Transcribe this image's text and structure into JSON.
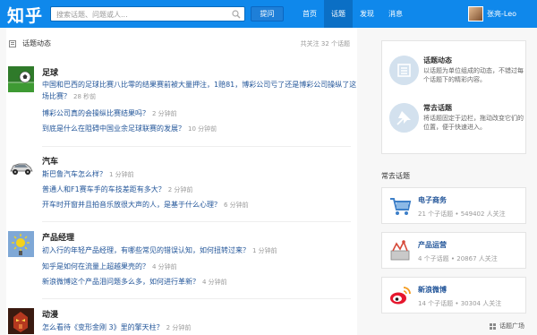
{
  "header": {
    "logo": "知乎",
    "search_placeholder": "搜索话题、问题或人...",
    "ask_button": "提问",
    "nav": [
      "首页",
      "话题",
      "发现",
      "消息"
    ],
    "active_nav": "话题",
    "user_name": "张亮-Leo"
  },
  "main": {
    "title": "话题动态",
    "follow_count": "共关注 32 个话题",
    "topics": [
      {
        "name": "足球",
        "questions": [
          {
            "text": "中国和巴西的足球比赛八比零的结果赛前被大量押注，1赔81，博彩公司亏了还是博彩公司操纵了这场比赛？",
            "line1": "中国和巴西的足球比赛八比零的结果赛前被大量押注，1赔81，博彩公司亏了还是博彩公司操纵了这",
            "line2": "场比赛？",
            "time": "28 秒前"
          },
          {
            "text": "博彩公司真的会操纵比赛结果吗？",
            "time": "2 分钟前"
          },
          {
            "text": "到底是什么在阻碍中国业余足球联赛的发展？",
            "time": "10 分钟前"
          }
        ]
      },
      {
        "name": "汽车",
        "questions": [
          {
            "text": "斯巴鲁汽车怎么样？",
            "time": "1 分钟前"
          },
          {
            "text": "普通人和F1赛车手的车技差距有多大？",
            "time": "2 分钟前"
          },
          {
            "text": "开车时开窗并且拍音乐放很大声的人，是基于什么心理？",
            "time": "6 分钟前"
          }
        ]
      },
      {
        "name": "产品经理",
        "questions": [
          {
            "text": "初入行的年轻产品经理，有哪些常见的错误认知，如何扭转过来？",
            "time": "1 分钟前"
          },
          {
            "text": "知乎是如何在流量上超越果壳的？",
            "time": "4 分钟前"
          },
          {
            "text": "新浪微博这个产品泪问题多么多，如何进行革新？",
            "time": "4 分钟前"
          }
        ]
      },
      {
        "name": "动漫",
        "questions": [
          {
            "text": "怎么看待《变形金刚 3》里的擎天柱？",
            "time": "2 分钟前"
          }
        ]
      }
    ]
  },
  "sidebar": {
    "entries": [
      {
        "title": "话题动态",
        "desc": "以话题为单位组成的动态，不错过每个话题下的精彩内容。",
        "icon": "list-icon"
      },
      {
        "title": "常去话题",
        "desc": "将话题固定于边栏，拖动改变它们的位置，便于快速进入。",
        "icon": "pin-icon"
      }
    ],
    "frequent_title": "常去话题",
    "frequent": [
      {
        "name": "电子商务",
        "stats": "21 个子话题 • 549402 人关注"
      },
      {
        "name": "产品运营",
        "stats": "4 个子话题 • 20867 人关注"
      },
      {
        "name": "新浪微博",
        "stats": "14 个子话题 • 30304 人关注"
      }
    ],
    "square_link": "话题广场"
  },
  "colors": {
    "header": "#0f88eb",
    "link": "#225599"
  }
}
